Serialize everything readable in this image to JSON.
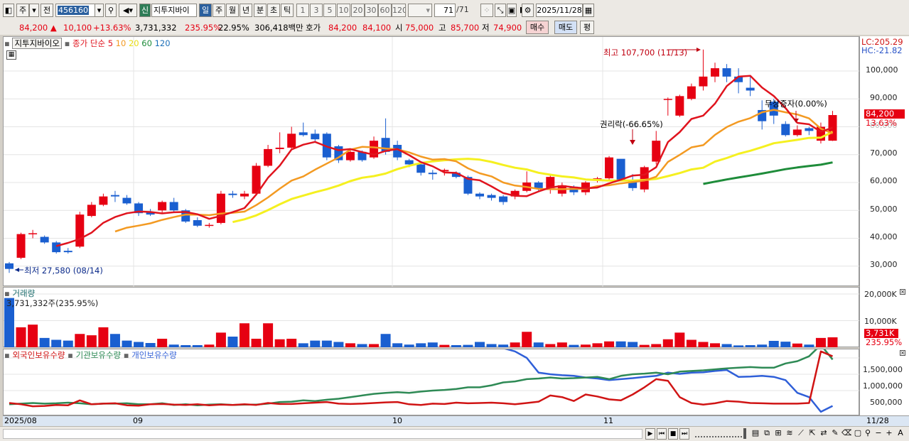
{
  "toolbar": {
    "b1": "주",
    "b2": "전",
    "code": "456160",
    "badge": "신",
    "name": "지투지바이",
    "periods": [
      "일",
      "주",
      "월",
      "년",
      "분",
      "초",
      "틱"
    ],
    "nums": [
      "1",
      "3",
      "5",
      "10",
      "20",
      "30",
      "60",
      "120"
    ],
    "count": "71",
    "total": "/71",
    "date": "2025/11/28"
  },
  "quote": {
    "price": "84,200 ▲",
    "change": "10,100",
    "pct": "+13.63%",
    "volume": "3,731,332",
    "vol_pct": "235.95%",
    "turnover": "22.95%",
    "amount": "306,418백만",
    "hoga_label": "호가",
    "hoga1": "84,200",
    "hoga2": "84,100",
    "open_label": "시",
    "open": "75,000",
    "high_label": "고",
    "high": "85,700",
    "low_label": "저",
    "low": "74,900",
    "buy": "매수",
    "sell": "매도",
    "flat": "평"
  },
  "legend": {
    "name": "지투지바이오",
    "ma_title": "종가 단순",
    "ma5": "5",
    "ma10": "10",
    "ma20": "20",
    "ma60": "60",
    "ma120": "120"
  },
  "annotations": {
    "high": "최고 107,700 (11/13)",
    "low": "최저 27,580 (08/14)",
    "rights": "권리락(-66.65%)",
    "bonus": "무상증자(0.00%)"
  },
  "right_axis": {
    "lc": "LC:205.29",
    "hc": "HC:-21.82",
    "price_tag": "84,200",
    "pct_tag": "13.63%",
    "vol_tag": "3,731K",
    "vol_pct_tag": "235.95%"
  },
  "volume": {
    "title": "거래량",
    "info": "3,731,332주(235.95%)"
  },
  "holdings": {
    "l1": "외국인보유수량",
    "l2": "기관보유수량",
    "l3": "개인보유수량"
  },
  "dates": {
    "d0": "2025/08",
    "d1": "09",
    "d2": "10",
    "d3": "11",
    "d_end": "11/28"
  },
  "colors": {
    "up": "#e60012",
    "down": "#1a5fd0",
    "ma5": "#e0141e",
    "ma10": "#f39a22",
    "ma20": "#f5f020",
    "ma60": "#1e8c3a"
  },
  "chart_data": {
    "type": "candlestick",
    "dates": [
      "08/14",
      "08/18",
      "08/19",
      "08/20",
      "08/21",
      "08/22",
      "08/25",
      "08/26",
      "08/27",
      "08/28",
      "08/29",
      "09/01",
      "09/02",
      "09/03",
      "09/04",
      "09/05",
      "09/08",
      "09/09",
      "09/10",
      "09/11",
      "09/12",
      "09/15",
      "09/16",
      "09/17",
      "09/18",
      "09/19",
      "09/22",
      "09/23",
      "09/24",
      "09/25",
      "09/26",
      "09/29",
      "09/30",
      "10/01",
      "10/02",
      "10/10",
      "10/13",
      "10/14",
      "10/15",
      "10/16",
      "10/17",
      "10/20",
      "10/21",
      "10/22",
      "10/23",
      "10/24",
      "10/27",
      "10/28",
      "10/29",
      "10/30",
      "10/31",
      "11/03",
      "11/04",
      "11/05",
      "11/06",
      "11/07",
      "11/10",
      "11/11",
      "11/12",
      "11/13",
      "11/14",
      "11/17",
      "11/18",
      "11/19",
      "11/20",
      "11/21",
      "11/24",
      "11/25",
      "11/26",
      "11/27",
      "11/28"
    ],
    "open": [
      31000,
      33000,
      41500,
      40500,
      38500,
      35500,
      37000,
      48000,
      52000,
      55500,
      54500,
      52500,
      49500,
      50000,
      53000,
      50000,
      46500,
      44800,
      45500,
      56000,
      55000,
      56000,
      66000,
      72000,
      72500,
      78000,
      77500,
      77500,
      73000,
      68000,
      71000,
      69000,
      76000,
      73500,
      68000,
      66500,
      63500,
      64000,
      63500,
      62000,
      56000,
      55500,
      55000,
      55000,
      57000,
      60000,
      58000,
      56000,
      58500,
      56500,
      61000,
      61500,
      68500,
      61000,
      57500,
      67500,
      90000,
      84000,
      90000,
      94500,
      98000,
      101000,
      98000,
      94000,
      86000,
      89000,
      81000,
      77000,
      79500,
      75000,
      75000
    ],
    "close": [
      29000,
      41500,
      41800,
      38500,
      35000,
      35000,
      48500,
      52000,
      55000,
      55000,
      52500,
      49000,
      48500,
      53000,
      50000,
      46000,
      44500,
      44800,
      56000,
      55500,
      56000,
      66000,
      72000,
      72500,
      77500,
      77000,
      75500,
      69000,
      68000,
      71000,
      68000,
      75000,
      71000,
      69000,
      66500,
      63500,
      63000,
      64500,
      62000,
      56000,
      55000,
      54500,
      53000,
      57000,
      60000,
      58000,
      62000,
      59000,
      56500,
      60000,
      61500,
      69000,
      61000,
      58000,
      65500,
      75000,
      90000,
      91000,
      94500,
      98000,
      101000,
      98000,
      96000,
      93000,
      82000,
      84000,
      77000,
      79000,
      78500,
      80000,
      84200
    ],
    "high": [
      31500,
      42000,
      43000,
      41000,
      39000,
      36500,
      49500,
      53000,
      56000,
      57000,
      55500,
      53000,
      50500,
      53500,
      54500,
      50500,
      47500,
      45500,
      57000,
      57000,
      57000,
      67000,
      73500,
      78000,
      80000,
      81500,
      79000,
      78000,
      73500,
      71500,
      71500,
      76500,
      83000,
      75000,
      68500,
      67000,
      64500,
      65000,
      64000,
      62500,
      56500,
      56000,
      55500,
      57500,
      64000,
      60500,
      62500,
      60000,
      59000,
      60500,
      62000,
      69500,
      61500,
      63000,
      66000,
      78500,
      90500,
      91500,
      95500,
      107700,
      103000,
      102500,
      101000,
      98500,
      89500,
      90000,
      82000,
      80500,
      80000,
      81500,
      85700
    ],
    "low": [
      27580,
      32500,
      40000,
      38000,
      34500,
      34500,
      36500,
      47500,
      51500,
      53000,
      52000,
      48000,
      48000,
      49000,
      49500,
      45500,
      44000,
      43800,
      45000,
      54500,
      54000,
      55500,
      65500,
      70500,
      71500,
      76500,
      74500,
      68000,
      67000,
      67500,
      67500,
      68500,
      70000,
      68000,
      65500,
      62500,
      61000,
      62500,
      61500,
      55500,
      54000,
      53500,
      52000,
      54000,
      56500,
      57000,
      56000,
      55000,
      55500,
      55500,
      60000,
      60500,
      60500,
      57000,
      56500,
      66500,
      84000,
      83500,
      89500,
      93000,
      96000,
      96000,
      92000,
      91000,
      79000,
      81000,
      76500,
      76500,
      77000,
      74000,
      74900
    ],
    "ma5": [
      null,
      null,
      null,
      null,
      37200,
      38350,
      39760,
      42010,
      45550,
      47610,
      48960,
      49580,
      49420,
      48920,
      49320,
      49420,
      48620,
      46960,
      48040,
      49380,
      50840,
      55700,
      61700,
      66100,
      71850,
      73570,
      74570,
      72900,
      71600,
      72010,
      70900,
      70000,
      71300,
      72000,
      69800,
      67300,
      65800,
      63600,
      63460,
      61300,
      60800,
      58600,
      56200,
      55200,
      55100,
      56800,
      58200,
      58800,
      58300,
      57900,
      58200,
      59700,
      61000,
      62500,
      62800,
      65500,
      74500,
      78100,
      82800,
      84000,
      88300,
      94600,
      98000,
      98300,
      94100,
      91000,
      86700,
      81400,
      80900,
      78200,
      79700
    ],
    "ma10": [
      null,
      null,
      null,
      null,
      null,
      null,
      null,
      null,
      null,
      42420,
      43790,
      44540,
      45350,
      46610,
      47600,
      48500,
      48480,
      48280,
      48870,
      49150,
      49560,
      51900,
      54640,
      57800,
      60700,
      62200,
      64600,
      66800,
      69000,
      71800,
      72800,
      72600,
      72200,
      71900,
      70800,
      69300,
      68200,
      68400,
      67600,
      65100,
      63300,
      62200,
      60000,
      58900,
      58400,
      57700,
      57600,
      57600,
      57700,
      57700,
      58700,
      59000,
      59700,
      60200,
      60700,
      62100,
      67400,
      69900,
      72600,
      73400,
      77100,
      79900,
      81800,
      83100,
      85200,
      86100,
      85200,
      84400,
      83000,
      79300,
      77600
    ],
    "ma20": [
      null,
      null,
      null,
      null,
      null,
      null,
      null,
      null,
      null,
      null,
      null,
      null,
      null,
      null,
      null,
      null,
      null,
      null,
      null,
      45800,
      46800,
      48200,
      50100,
      52200,
      54100,
      55300,
      56500,
      57600,
      58900,
      60500,
      61700,
      62300,
      63200,
      64800,
      66000,
      67000,
      67600,
      68000,
      68300,
      68500,
      68200,
      67400,
      66300,
      65300,
      64700,
      63500,
      62800,
      62200,
      61800,
      61100,
      60900,
      60700,
      60700,
      60700,
      60900,
      61300,
      62300,
      63400,
      64700,
      65300,
      67500,
      68800,
      70300,
      71400,
      72700,
      74100,
      74700,
      75300,
      76000,
      76100,
      78200
    ],
    "ma60": [
      null,
      null,
      null,
      null,
      null,
      null,
      null,
      null,
      null,
      null,
      null,
      null,
      null,
      null,
      null,
      null,
      null,
      null,
      null,
      null,
      null,
      null,
      null,
      null,
      null,
      null,
      null,
      null,
      null,
      null,
      null,
      null,
      null,
      null,
      null,
      null,
      null,
      null,
      null,
      null,
      null,
      null,
      null,
      null,
      null,
      null,
      null,
      null,
      null,
      null,
      null,
      null,
      null,
      null,
      null,
      null,
      null,
      null,
      null,
      59500,
      60300,
      61100,
      61800,
      62500,
      63200,
      64000,
      64800,
      65400,
      65900,
      66400,
      67200
    ],
    "volume": [
      18.5,
      7.5,
      8.5,
      3.5,
      2.8,
      2.5,
      5.0,
      4.5,
      7.5,
      5.0,
      2.5,
      2.0,
      1.6,
      3.2,
      1.0,
      0.8,
      0.8,
      1.0,
      5.5,
      4.0,
      9.0,
      3.2,
      9.0,
      3.0,
      3.2,
      1.5,
      2.5,
      2.5,
      2.0,
      1.5,
      1.2,
      1.2,
      5.0,
      1.5,
      1.0,
      1.5,
      1.8,
      0.9,
      0.8,
      0.9,
      2.0,
      1.2,
      1.0,
      1.8,
      5.8,
      1.8,
      1.2,
      1.8,
      0.9,
      1.0,
      1.5,
      2.2,
      2.2,
      2.0,
      0.9,
      1.2,
      3.0,
      5.5,
      2.8,
      2.0,
      1.5,
      1.2,
      0.7,
      0.8,
      1.0,
      2.4,
      2.1,
      1.4,
      1.0,
      3.5,
      3.731
    ],
    "foreign_hold": [
      1950,
      1920,
      1920,
      1940,
      1960,
      1960,
      1990,
      2000,
      2010,
      2010,
      2030,
      2050,
      2050,
      2030,
      2020,
      2000,
      1990,
      1960,
      1950,
      1940,
      1920,
      1900,
      1880,
      1930,
      1970,
      1980,
      1980,
      1970,
      1960,
      1940,
      1960,
      1970,
      1980,
      1960,
      1950,
      1930,
      1920,
      1880,
      1880,
      1860,
      1840,
      1820,
      1800,
      1700,
      1500,
      1050,
      1000,
      970,
      950,
      900,
      870,
      820,
      850,
      880,
      920,
      950,
      1050,
      1010,
      1050,
      1060,
      1100,
      1130,
      920,
      930,
      950,
      920,
      820,
      430,
      300,
      -150,
      30
    ],
    "inst_hold": [
      80,
      100,
      120,
      100,
      110,
      130,
      110,
      80,
      100,
      100,
      110,
      80,
      80,
      110,
      60,
      80,
      50,
      70,
      80,
      60,
      70,
      70,
      100,
      150,
      160,
      200,
      180,
      220,
      250,
      300,
      350,
      400,
      430,
      450,
      430,
      470,
      500,
      520,
      550,
      600,
      600,
      660,
      750,
      780,
      850,
      870,
      900,
      870,
      880,
      900,
      920,
      850,
      950,
      1000,
      1020,
      1050,
      1000,
      1080,
      1100,
      1120,
      1150,
      1180,
      1200,
      1220,
      1200,
      1200,
      1330,
      1400,
      1550,
      1900,
      1450
    ],
    "indiv_hold": [
      120,
      80,
      20,
      30,
      60,
      50,
      200,
      80,
      100,
      110,
      50,
      40,
      80,
      90,
      70,
      60,
      80,
      50,
      70,
      60,
      80,
      60,
      120,
      90,
      90,
      110,
      130,
      150,
      100,
      90,
      100,
      120,
      140,
      150,
      80,
      60,
      100,
      90,
      130,
      110,
      120,
      130,
      110,
      80,
      120,
      160,
      350,
      300,
      180,
      380,
      320,
      230,
      200,
      380,
      600,
      850,
      800,
      300,
      120,
      70,
      110,
      180,
      160,
      120,
      110,
      100,
      100,
      100,
      120,
      1700,
      1550
    ]
  }
}
